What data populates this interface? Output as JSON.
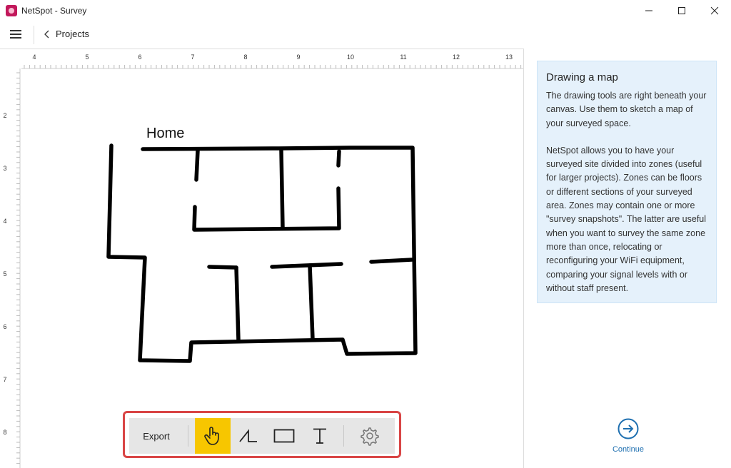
{
  "window": {
    "title": "NetSpot - Survey"
  },
  "nav": {
    "back_label": "Projects"
  },
  "canvas": {
    "ruler_top": [
      "4",
      "5",
      "6",
      "7",
      "8",
      "9",
      "10",
      "11",
      "12",
      "13"
    ],
    "ruler_left": [
      "2",
      "3",
      "4",
      "5",
      "6",
      "7",
      "8"
    ],
    "map_label": "Home"
  },
  "help": {
    "title": "Drawing a map",
    "p1": "The drawing tools are right beneath your canvas. Use them to sketch a map of your surveyed space.",
    "p2": "NetSpot allows you to have your surveyed site divided into zones (useful for larger projects). Zones can be floors or different sections of your surveyed area. Zones may contain one or more \"survey snapshots\". The latter are useful when you want to survey the same zone more than once, relocating or reconfiguring your WiFi equipment, comparing your signal levels with or without staff present."
  },
  "toolbar": {
    "export_label": "Export",
    "active_tool": "hand-tool",
    "active_color": "#f7c600",
    "highlight_color": "#d94545"
  },
  "continue": {
    "label": "Continue"
  },
  "colors": {
    "accent": "#1e6fb0",
    "help_bg": "#e5f1fb"
  }
}
